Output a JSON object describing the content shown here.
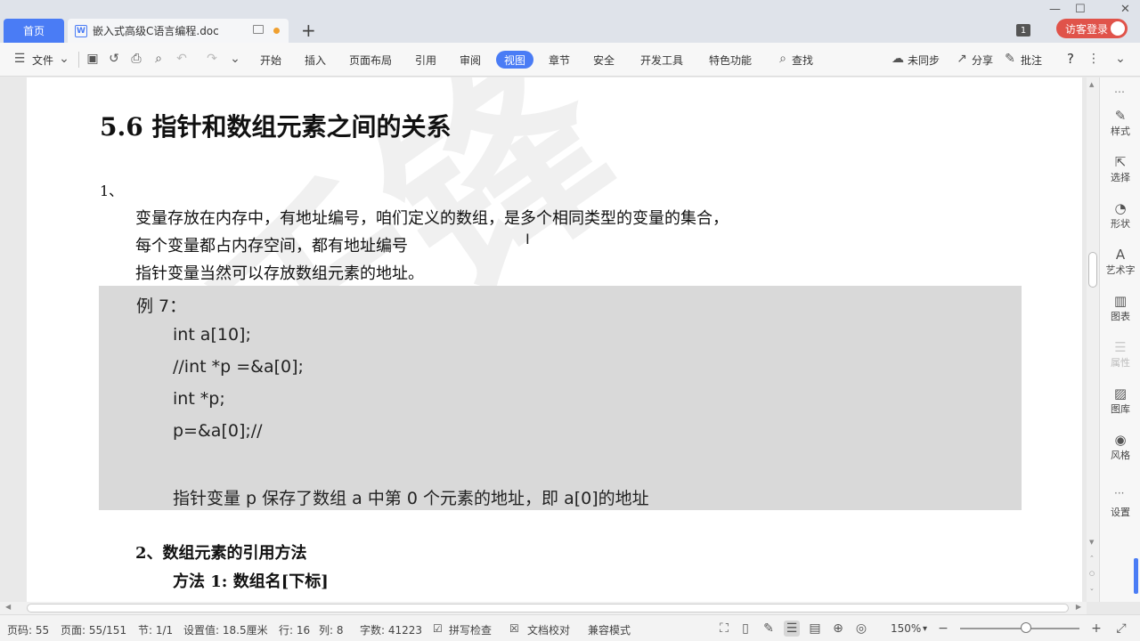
{
  "tabs": {
    "home": "首页",
    "doc": "嵌入式高级C语言编程.doc",
    "add": "+"
  },
  "titlebar": {
    "badge": "1",
    "login": "访客登录"
  },
  "menu": {
    "file": "文件",
    "items": [
      "开始",
      "插入",
      "页面布局",
      "引用",
      "审阅",
      "视图",
      "章节",
      "安全",
      "开发工具",
      "特色功能"
    ],
    "active": "视图",
    "search": "查找",
    "sync": "未同步",
    "share": "分享",
    "comment": "批注",
    "help": "?"
  },
  "document": {
    "heading": "5.6  指针和数组元素之间的关系",
    "item1": "1、",
    "para_lines": [
      "变量存放在内存中，有地址编号，咱们定义的数组，是多个相同类型的变量的集合，",
      "每个变量都占内存空间，都有地址编号",
      "指针变量当然可以存放数组元素的地址。"
    ],
    "example": {
      "title": "例 7：",
      "code": [
        "int    a[10];",
        "//int *p =&a[0];",
        "int *p;",
        "p=&a[0];//"
      ],
      "note": "指针变量 p 保存了数组 a 中第 0 个元素的地址，即 a[0]的地址"
    },
    "section2": "2、数组元素的引用方法",
    "method1": "方法 1:    数组名[下标]",
    "watermark": "千锋"
  },
  "right_panel": [
    {
      "label": "样式",
      "icon": "brush-icon"
    },
    {
      "label": "选择",
      "icon": "cursor-icon"
    },
    {
      "label": "形状",
      "icon": "shape-icon"
    },
    {
      "label": "艺术字",
      "icon": "wordart-icon"
    },
    {
      "label": "图表",
      "icon": "chart-icon"
    },
    {
      "label": "属性",
      "icon": "properties-icon"
    },
    {
      "label": "图库",
      "icon": "gallery-icon"
    },
    {
      "label": "风格",
      "icon": "style-icon"
    },
    {
      "label": "设置",
      "icon": "settings-icon"
    }
  ],
  "status": {
    "page_code": "页码: 55",
    "pages": "页面: 55/151",
    "section": "节: 1/1",
    "setting": "设置值: 18.5厘米",
    "row": "行: 16",
    "col": "列: 8",
    "words": "字数: 41223",
    "spell": "拼写检查",
    "proof": "文档校对",
    "compat": "兼容模式",
    "zoom": "150%",
    "zoom_level": 0.5
  },
  "colors": {
    "accent": "#4a7cf5",
    "login_red": "#e0534a",
    "example_bg": "#d9d9d9"
  }
}
